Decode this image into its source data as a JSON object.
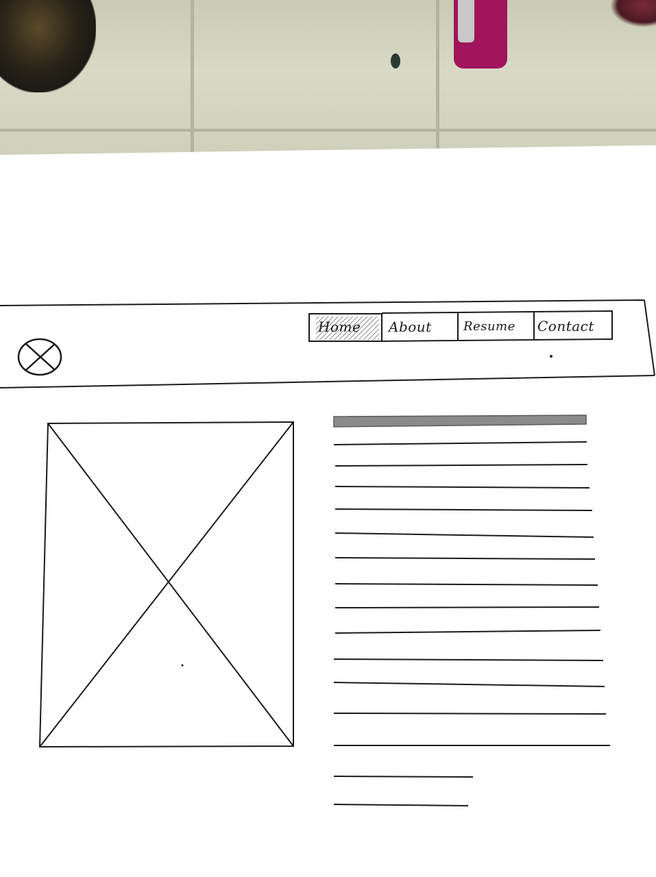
{
  "nav": {
    "items": [
      {
        "label": "Home",
        "active": true
      },
      {
        "label": "About",
        "active": false
      },
      {
        "label": "Resume",
        "active": false
      },
      {
        "label": "Contact",
        "active": false
      }
    ]
  },
  "logo": {
    "icon": "circle-x-logo-icon"
  },
  "hero_image": {
    "icon": "image-placeholder-icon"
  },
  "text_block": {
    "line_count": 16
  },
  "colors": {
    "ink": "#1a1a1a",
    "paper": "#ffffff",
    "active_fill": "#c8c8c8",
    "heading_bar": "#8a8a8a"
  }
}
